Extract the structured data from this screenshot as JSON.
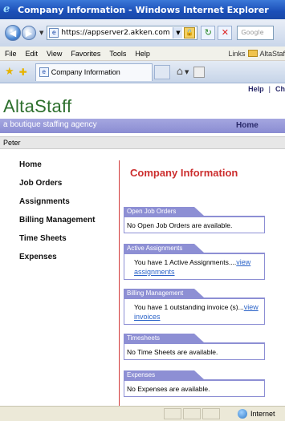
{
  "window": {
    "title": "Company Information - Windows Internet Explorer"
  },
  "browser": {
    "address": "https://appserver2.akken.com",
    "search_placeholder": "Google",
    "menu": [
      "File",
      "Edit",
      "View",
      "Favorites",
      "Tools",
      "Help"
    ],
    "links_label": "Links",
    "links_folder": "AltaStaf",
    "tab_title": "Company Information",
    "status_zone": "Internet"
  },
  "site": {
    "brand": "AltaStaff",
    "tagline": "a boutique staffing agency",
    "top_links": [
      "Help",
      "Ch"
    ],
    "home_label": "Home",
    "user": "Peter"
  },
  "nav": {
    "items": [
      "Home",
      "Job Orders",
      "Assignments",
      "Billing Management",
      "Time Sheets",
      "Expenses"
    ]
  },
  "content": {
    "title": "Company Information",
    "sections": [
      {
        "header": "Open Job Orders",
        "text": "No Open Job Orders are available.",
        "link": ""
      },
      {
        "header": "Active Assignments",
        "text": "You have 1 Active Assignments....",
        "link": "view assignments"
      },
      {
        "header": "Billing Management",
        "text": "You have 1 outstanding invoice (s)...",
        "link": "view invoices"
      },
      {
        "header": "Timesheets",
        "text": "No Time Sheets are available.",
        "link": ""
      },
      {
        "header": "Expenses",
        "text": "No Expenses are available.",
        "link": ""
      }
    ]
  }
}
